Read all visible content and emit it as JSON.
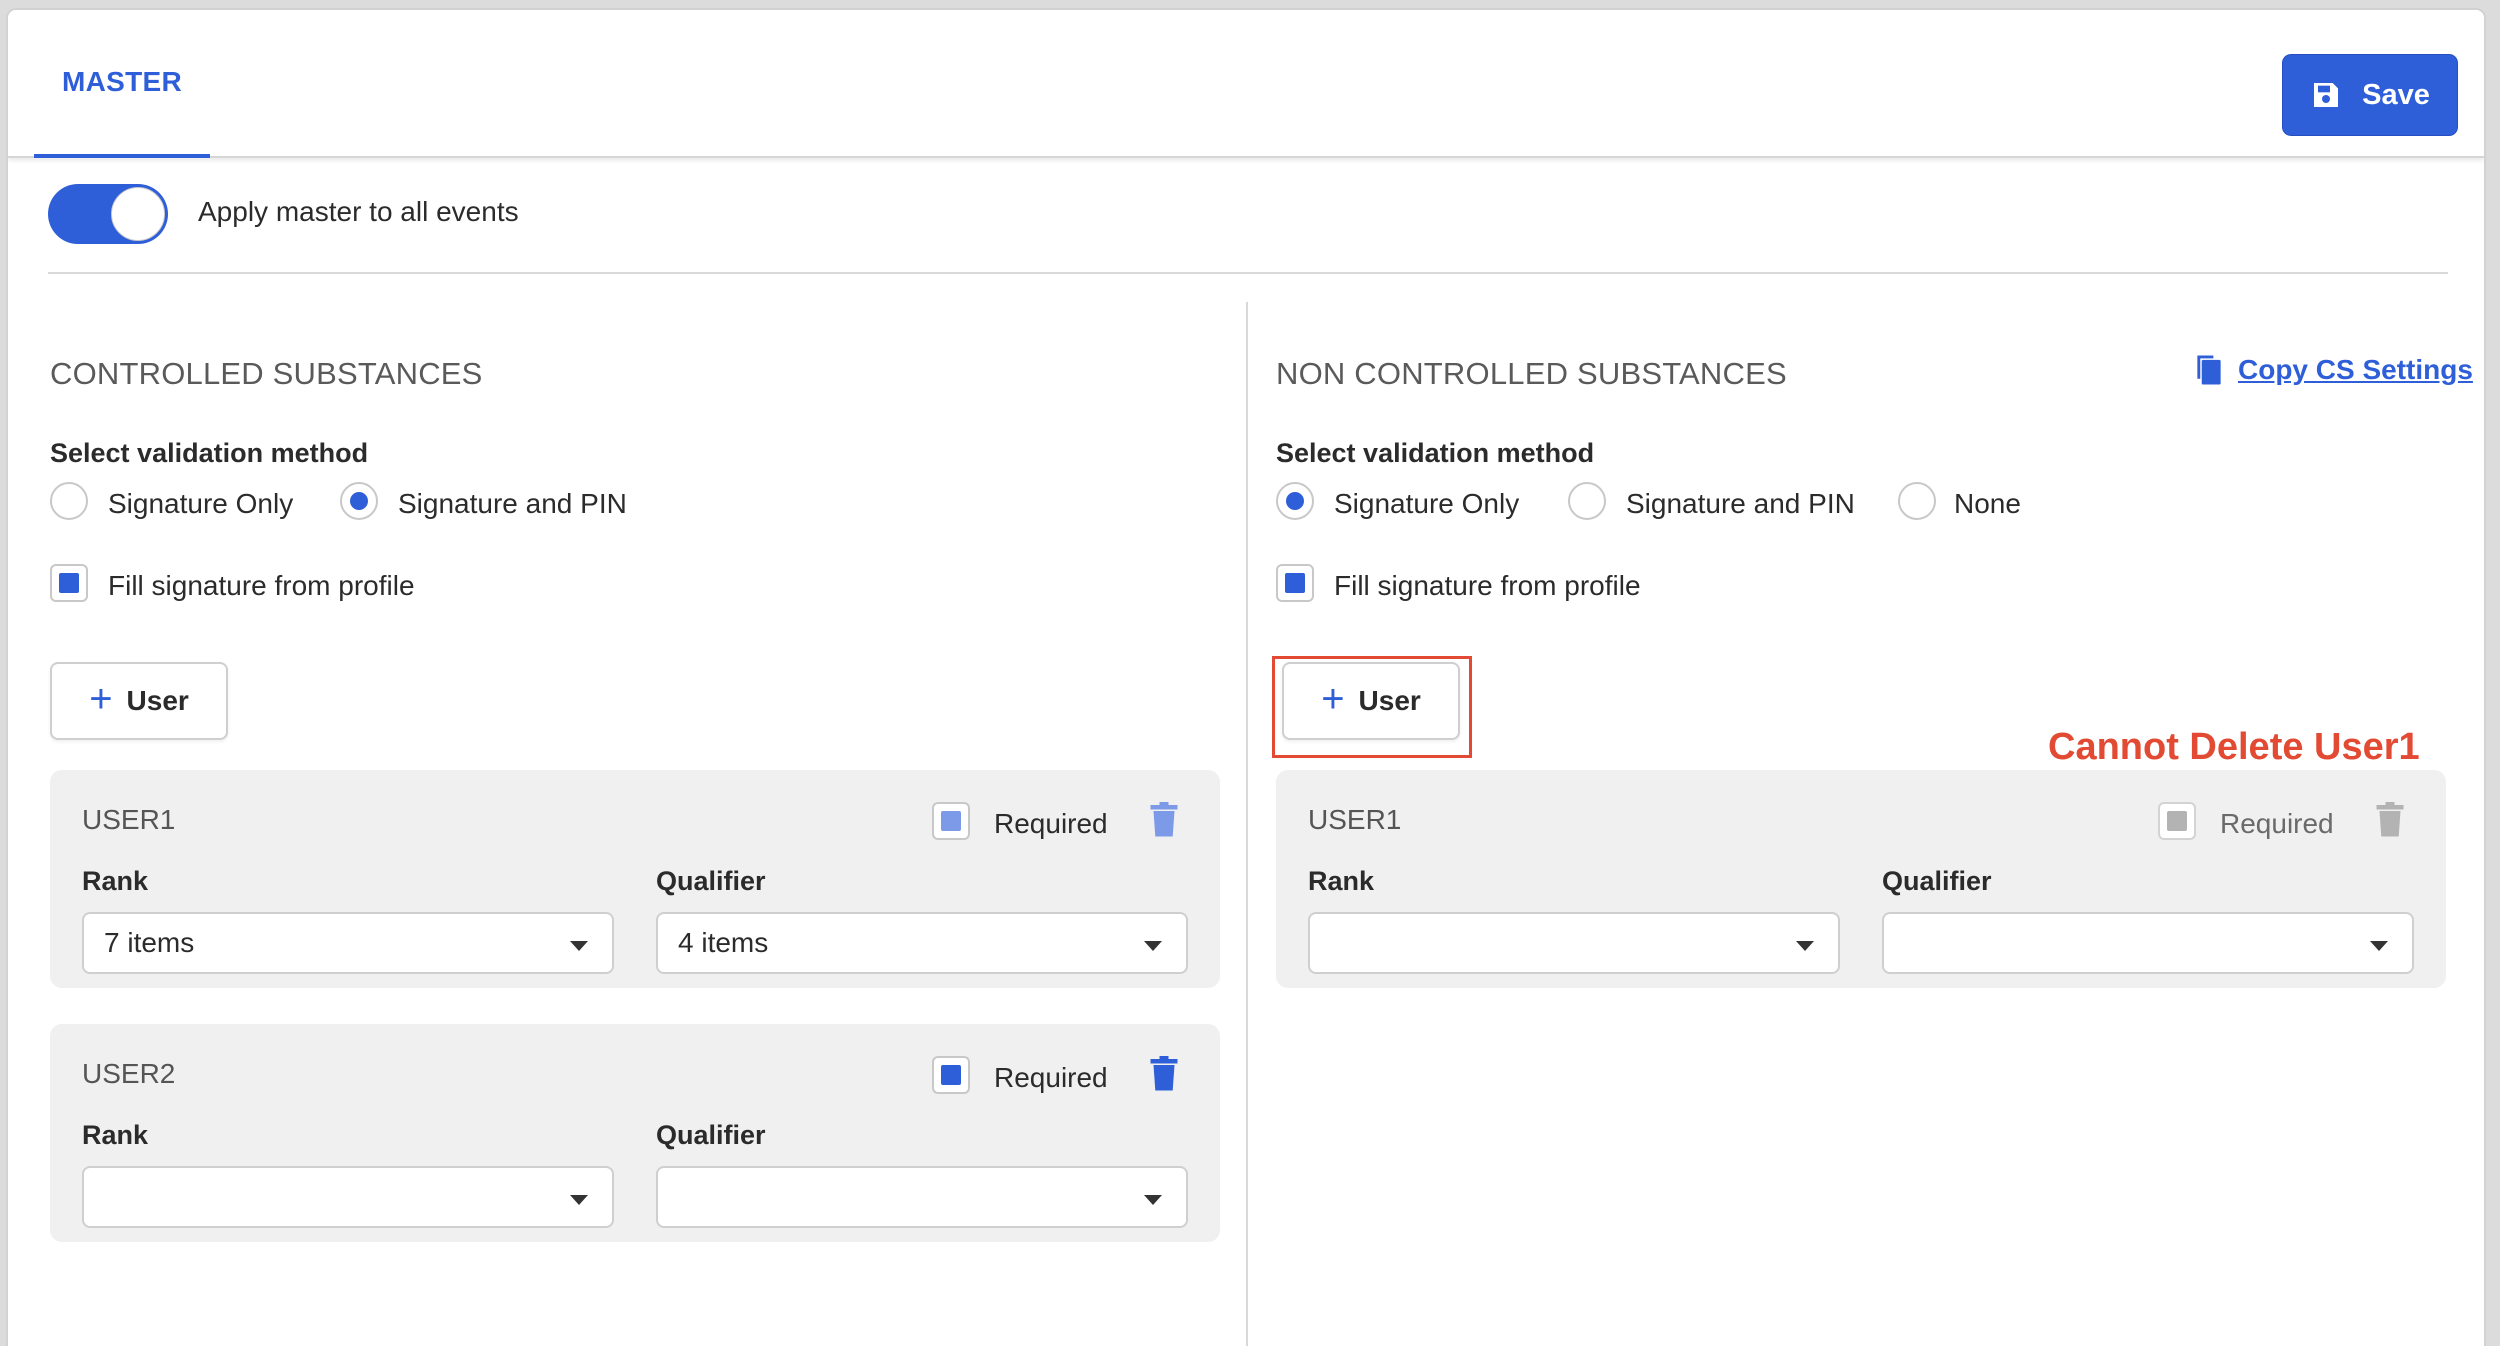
{
  "header": {
    "tab_label": "MASTER",
    "save_label": "Save"
  },
  "toggle": {
    "label": "Apply master to all events",
    "on": true
  },
  "controlled": {
    "title": "CONTROLLED SUBSTANCES",
    "validation_label": "Select validation method",
    "options": [
      "Signature Only",
      "Signature and PIN"
    ],
    "selected": "Signature and PIN",
    "fill_signature_label": "Fill signature from profile",
    "fill_signature_checked": true,
    "add_user_label": "User",
    "users": [
      {
        "title": "USER1",
        "required_label": "Required",
        "required": true,
        "rank_label": "Rank",
        "rank_value": "7 items",
        "qualifier_label": "Qualifier",
        "qualifier_value": "4 items"
      },
      {
        "title": "USER2",
        "required_label": "Required",
        "required": true,
        "rank_label": "Rank",
        "rank_value": "",
        "qualifier_label": "Qualifier",
        "qualifier_value": ""
      }
    ]
  },
  "non_controlled": {
    "title": "NON CONTROLLED SUBSTANCES",
    "copy_link": "Copy CS Settings",
    "validation_label": "Select validation method",
    "options": [
      "Signature Only",
      "Signature and PIN",
      "None"
    ],
    "selected": "Signature Only",
    "fill_signature_label": "Fill signature from profile",
    "fill_signature_checked": true,
    "add_user_label": "User",
    "annotation": "Cannot Delete User1",
    "users": [
      {
        "title": "USER1",
        "required_label": "Required",
        "required": true,
        "disabled": true,
        "rank_label": "Rank",
        "rank_value": "",
        "qualifier_label": "Qualifier",
        "qualifier_value": ""
      }
    ]
  },
  "colors": {
    "accent": "#2f5fd8",
    "annotation": "#e24a33",
    "card_bg": "#f0f0f0"
  }
}
